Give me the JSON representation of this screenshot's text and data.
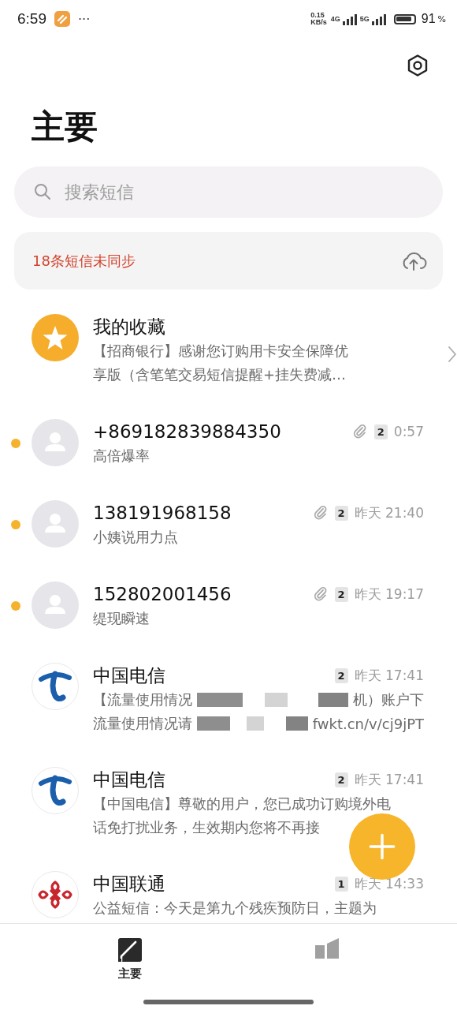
{
  "status_bar": {
    "time": "6:59",
    "more": "···",
    "speed": "0.15",
    "speed_unit": "KB/s",
    "network_1": "4G",
    "network_2": "5G",
    "battery": "91",
    "battery_unit": "%"
  },
  "title": "主要",
  "search": {
    "placeholder": "搜索短信"
  },
  "sync_banner": {
    "text": "18条短信未同步"
  },
  "conversations": [
    {
      "kind": "star",
      "name": "我的收藏",
      "unread": false,
      "attachment": false,
      "chevron": true,
      "preview": [
        [
          "【招商银行】感谢您订购用卡安全保障优"
        ],
        [
          "享版（含笔笔交易短信提醒+挂失费减…"
        ]
      ]
    },
    {
      "kind": "person",
      "name": "+869182839884350",
      "unread": true,
      "attachment": true,
      "sim": "2",
      "time": "0:57",
      "preview": [
        [
          "高倍爆率"
        ]
      ]
    },
    {
      "kind": "person",
      "name": "138191968158",
      "unread": true,
      "attachment": true,
      "sim": "2",
      "time": "昨天 21:40",
      "preview": [
        [
          "小姨说用力点"
        ]
      ]
    },
    {
      "kind": "person",
      "name": "152802001456",
      "unread": true,
      "attachment": true,
      "sim": "2",
      "time": "昨天 19:17",
      "preview": [
        [
          "缇现瞬速"
        ]
      ]
    },
    {
      "kind": "telecom",
      "name": "中国电信",
      "unread": false,
      "attachment": false,
      "sim": "2",
      "time": "昨天 17:41",
      "preview": [
        [
          "【流量使用情况",
          "机）账户下"
        ],
        [
          "流量使用情况请",
          "fwkt.cn/v/cj9jPT"
        ]
      ]
    },
    {
      "kind": "telecom",
      "name": "中国电信",
      "unread": false,
      "attachment": false,
      "sim": "2",
      "time": "昨天 17:41",
      "preview": [
        [
          "【中国电信】尊敬的用户，您已成功订购境外电"
        ],
        [
          "话免打扰业务，生效期内您将不再接"
        ]
      ]
    },
    {
      "kind": "unicom",
      "name": "中国联通",
      "unread": false,
      "attachment": false,
      "sim": "1",
      "time": "昨天 14:33",
      "preview": [
        [
          "公益短信：今天是第九个残疾预防日，主题为"
        ]
      ]
    }
  ],
  "bottom_tabs": [
    {
      "label": "主要",
      "selected": true,
      "kind": "compose"
    },
    {
      "selected": false,
      "kind": "blocks"
    }
  ]
}
